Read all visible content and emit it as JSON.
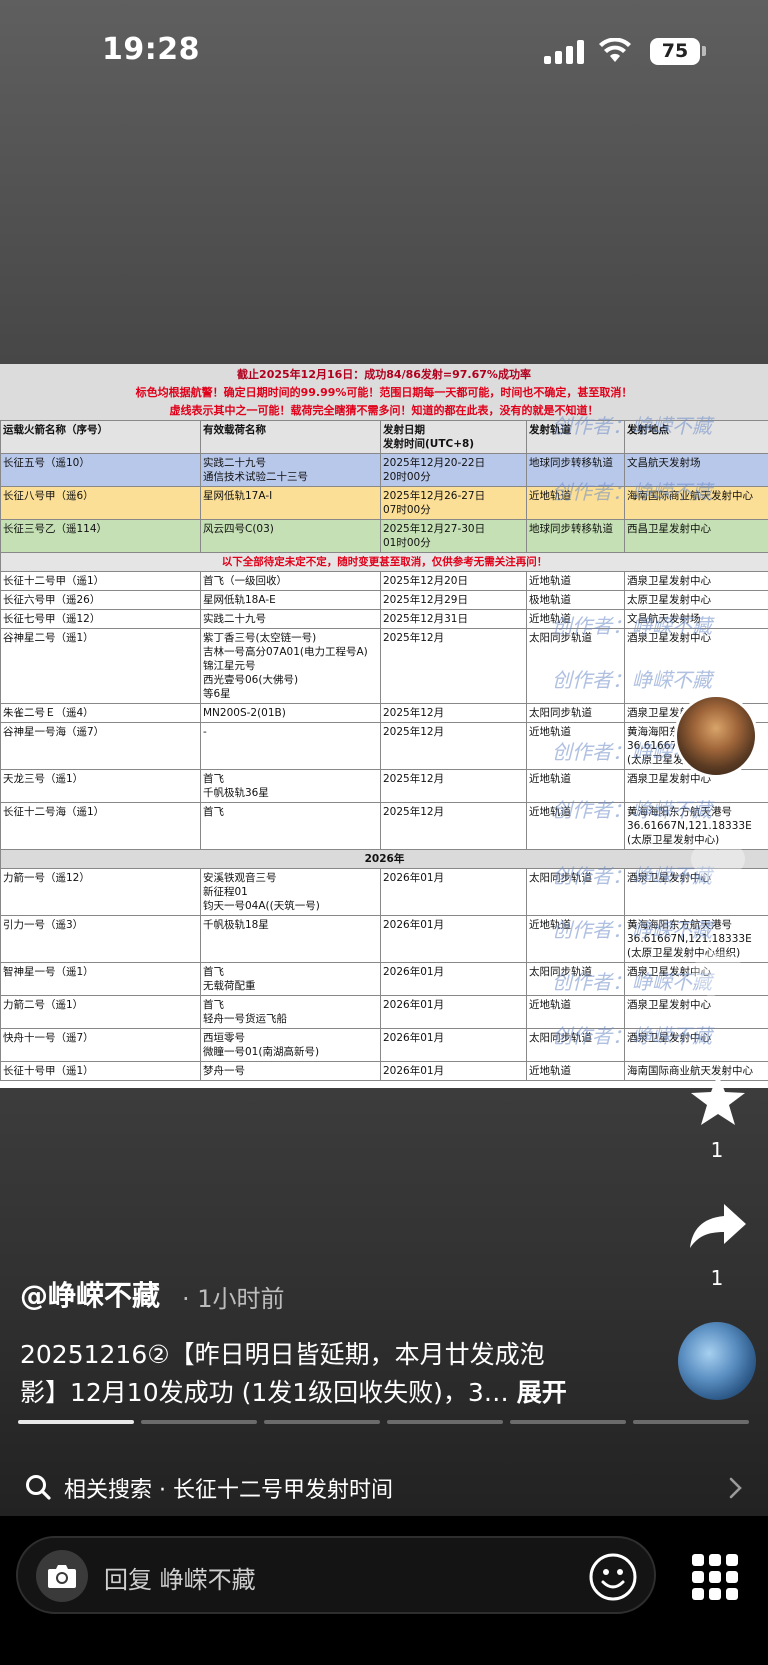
{
  "status_bar": {
    "time": "19:28",
    "battery": "75"
  },
  "table": {
    "header_lines": [
      "截止2025年12月16日：成功84/86发射=97.67%成功率",
      "标色均根据航警！确定日期时间的99.99%可能！范围日期每一天都可能，时间也不确定，甚至取消！",
      "虚线表示其中之一可能！载荷完全瞎猜不需多问！知道的都在此表，没有的就是不知道！"
    ],
    "columns": [
      "运载火箭名称（序号）",
      "有效载荷名称",
      "发射日期",
      "发射时间(UTC+8)",
      "发射轨道",
      "发射地点"
    ],
    "confirmed_rows": [
      {
        "rocket": "长征五号（遥10）",
        "payload": [
          "实践二十九号",
          "通信技术试验二十三号"
        ],
        "date": [
          "2025年12月20-22日",
          "20时00分"
        ],
        "orbit": "地球同步转移轨道",
        "site": [
          "文昌航天发射场"
        ]
      },
      {
        "rocket": "长征八号甲（遥6）",
        "payload": [
          "星网低轨17A-I"
        ],
        "date": [
          "2025年12月26-27日",
          "07时00分"
        ],
        "orbit": "近地轨道",
        "site": [
          "海南国际商业航天发射中心"
        ]
      },
      {
        "rocket": "长征三号乙（遥114）",
        "payload": [
          "风云四号C(03)"
        ],
        "date": [
          "2025年12月27-30日",
          "01时00分"
        ],
        "orbit": "地球同步转移轨道",
        "site": [
          "西昌卫星发射中心"
        ]
      }
    ],
    "notice": "以下全部待定未定不定，随时变更甚至取消，仅供参考无需关注再问！",
    "tentative_rows": [
      {
        "rocket": "长征十二号甲（遥1）",
        "payload": [
          "首飞（一级回收）"
        ],
        "date": "2025年12月20日",
        "orbit": "近地轨道",
        "site": [
          "酒泉卫星发射中心"
        ]
      },
      {
        "rocket": "长征六号甲（遥26）",
        "payload": [
          "星网低轨18A-E"
        ],
        "date": "2025年12月29日",
        "orbit": "极地轨道",
        "site": [
          "太原卫星发射中心"
        ]
      },
      {
        "rocket": "长征七号甲（遥12）",
        "payload": [
          "实践二十九号"
        ],
        "date": "2025年12月31日",
        "orbit": "近地轨道",
        "site": [
          "文昌航天发射场"
        ]
      },
      {
        "rocket": "谷神星二号（遥1）",
        "payload": [
          "紫丁香三号(太空链一号)",
          "吉林一号高分07A01(电力工程号A)",
          "锦江星元号",
          "西光壹号06(大佛号)",
          "等6星"
        ],
        "date": "2025年12月",
        "orbit": "太阳同步轨道",
        "site": [
          "酒泉卫星发射中心"
        ]
      },
      {
        "rocket": "朱雀二号Ｅ（遥4）",
        "payload": [
          "MN200S-2(01B)"
        ],
        "date": "2025年12月",
        "orbit": "太阳同步轨道",
        "site": [
          "酒泉卫星发射中心"
        ]
      },
      {
        "rocket": "谷神星一号海（遥7）",
        "payload": [
          "-"
        ],
        "date": "2025年12月",
        "orbit": "近地轨道",
        "site": [
          "黄海海阳东方航天港",
          "36.61667N,121.18333E",
          "(太原卫星发射中心组织)"
        ]
      },
      {
        "rocket": "天龙三号（遥1）",
        "payload": [
          "首飞",
          "千帆极轨36星"
        ],
        "date": "2025年12月",
        "orbit": "近地轨道",
        "site": [
          "酒泉卫星发射中心"
        ]
      },
      {
        "rocket": "长征十二号海（遥1）",
        "payload": [
          "首飞"
        ],
        "date": "2025年12月",
        "orbit": "近地轨道",
        "site": [
          "黄海海阳东方航天港号",
          "36.61667N,121.18333E",
          "(太原卫星发射中心)"
        ]
      }
    ],
    "year_label": "2026年",
    "rows_2026": [
      {
        "rocket": "力箭一号（遥12）",
        "payload": [
          "安溪铁观音三号",
          "新征程01",
          "钧天一号04A((天筑一号)"
        ],
        "date": "2026年01月",
        "orbit": "太阳同步轨道",
        "site": [
          "酒泉卫星发射中心"
        ]
      },
      {
        "rocket": "引力一号（遥3）",
        "payload": [
          "千帆极轨18星"
        ],
        "date": "2026年01月",
        "orbit": "近地轨道",
        "site": [
          "黄海海阳东方航天港号",
          "36.61667N,121.18333E",
          "(太原卫星发射中心组织)"
        ]
      },
      {
        "rocket": "智神星一号（遥1）",
        "payload": [
          "首飞",
          "无载荷配重"
        ],
        "date": "2026年01月",
        "orbit": "太阳同步轨道",
        "site": [
          "酒泉卫星发射中心"
        ]
      },
      {
        "rocket": "力箭二号（遥1）",
        "payload": [
          "首飞",
          "轻舟一号货运飞船"
        ],
        "date": "2026年01月",
        "orbit": "近地轨道",
        "site": [
          "酒泉卫星发射中心"
        ]
      },
      {
        "rocket": "快舟十一号（遥7）",
        "payload": [
          "西垣零号",
          "微瞳一号01(南湖高新号)"
        ],
        "date": "2026年01月",
        "orbit": "太阳同步轨道",
        "site": [
          "酒泉卫星发射中心"
        ]
      },
      {
        "rocket": "长征十号甲（遥1）",
        "payload": [
          "梦舟一号"
        ],
        "date": "2026年01月",
        "orbit": "近地轨道",
        "site": [
          "海南国际商业航天发射中心"
        ]
      }
    ],
    "watermark": "创作者：峥嵘不藏"
  },
  "side_actions": {
    "favorite_count": "1",
    "share_count": "1"
  },
  "post": {
    "author": "@峥嵘不藏",
    "time_ago": "· 1小时前",
    "description_line1": "20251216②【昨日明日皆延期，本月廿发成泡",
    "description_line2": "影】12月10发成功 (1发1级回收失败)，3…",
    "expand_label": "展开"
  },
  "related_search": {
    "prefix": "相关搜索",
    "separator": " · ",
    "query": "长征十二号甲发射时间"
  },
  "reply": {
    "placeholder": "回复 峥嵘不藏"
  }
}
